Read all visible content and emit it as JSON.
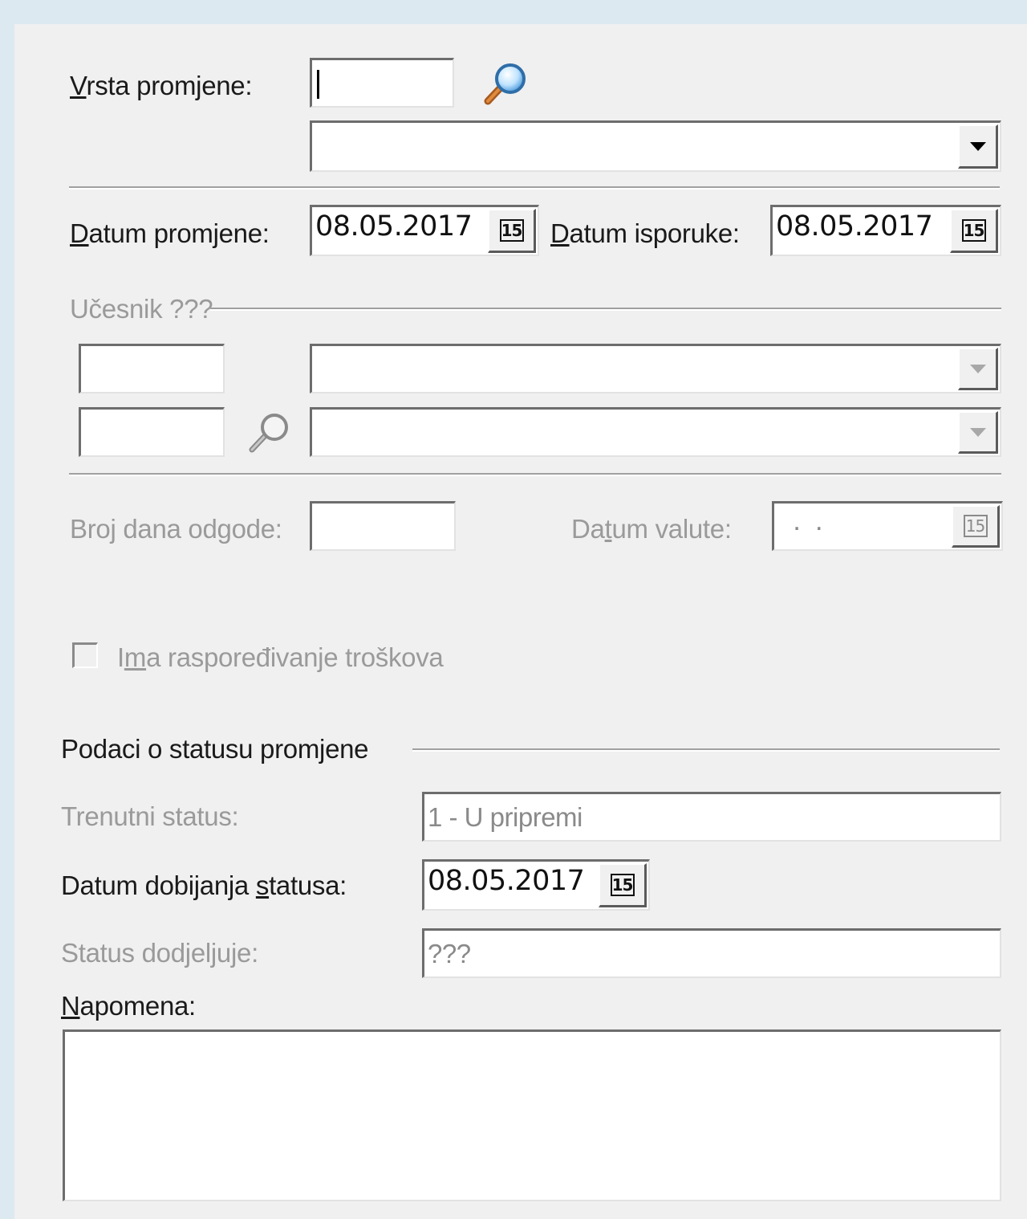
{
  "vrsta": {
    "label_u": "V",
    "label_rest": "rsta promjene:",
    "code_value": "",
    "select_value": ""
  },
  "datumi": {
    "promjene_label_u": "D",
    "promjene_label_rest": "atum promjene:",
    "promjene_value": "08.05.2017",
    "isporuke_label_u": "D",
    "isporuke_label_rest": "atum isporuke:",
    "isporuke_value": "08.05.2017",
    "calendar_glyph": "15"
  },
  "ucesnik": {
    "group_label": "Učesnik ???",
    "code1_value": "",
    "code2_value": "",
    "select1_value": "",
    "select2_value": ""
  },
  "odgoda": {
    "broj_dana_label": "Broj dana odgode:",
    "broj_dana_value": "",
    "valute_label_pre": "Da",
    "valute_label_u": "t",
    "valute_label_rest": "um valute:",
    "valute_value": " .  ."
  },
  "rasporedjivanje": {
    "label_pre": "I",
    "label_u": "m",
    "label_rest": "a raspoređivanje troškova",
    "checked": false
  },
  "status": {
    "section_title": "Podaci o statusu promjene",
    "trenutni_label": "Trenutni status:",
    "trenutni_value": "1 - U pripremi",
    "datum_label_pre": "Datum dobijanja ",
    "datum_label_u": "s",
    "datum_label_rest": "tatusa:",
    "datum_value": "08.05.2017",
    "dodjeljuje_label": "Status dodjeljuje:",
    "dodjeljuje_value": "???"
  },
  "napomena": {
    "label_u": "N",
    "label_rest": "apomena:",
    "value": ""
  },
  "icons": {
    "search": "magnifier-icon",
    "calendar": "calendar-icon"
  },
  "colors": {
    "window_bg": "#f0f0f0",
    "outer_bg": "#dde9f1",
    "disabled_text": "#9a9a9a"
  }
}
